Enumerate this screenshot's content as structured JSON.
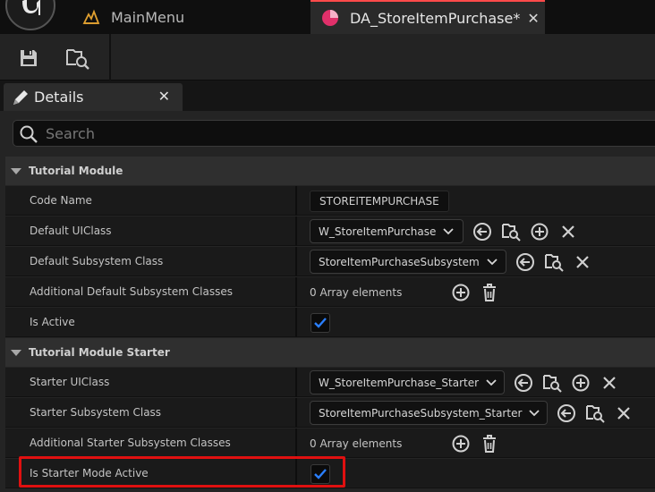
{
  "tabs": {
    "main_menu": "MainMenu",
    "active_asset": "DA_StoreItemPurchase*",
    "close": "✕"
  },
  "icons": {
    "unreal_logo": "unreal-logo-icon",
    "level": "level-icon",
    "data_asset": "data-asset-icon",
    "save": "save-icon",
    "browse": "browse-to-asset-icon",
    "details": "details-pencil-icon"
  },
  "details": {
    "title": "Details",
    "close": "✕",
    "search_placeholder": "Search"
  },
  "categories": [
    {
      "label": "Tutorial Module",
      "rows": [
        {
          "name": "Code Name",
          "value": "STOREITEMPURCHASE"
        },
        {
          "name": "Default UIClass",
          "value": "W_StoreItemPurchase"
        },
        {
          "name": "Default Subsystem Class",
          "value": "StoreItemPurchaseSubsystem"
        },
        {
          "name": "Additional Default Subsystem Classes",
          "value": "0 Array elements"
        },
        {
          "name": "Is Active",
          "checked": true
        }
      ]
    },
    {
      "label": "Tutorial Module Starter",
      "rows": [
        {
          "name": "Starter UIClass",
          "value": "W_StoreItemPurchase_Starter"
        },
        {
          "name": "Starter Subsystem Class",
          "value": "StoreItemPurchaseSubsystem_Starter"
        },
        {
          "name": "Additional Starter Subsystem Classes",
          "value": "0 Array elements"
        },
        {
          "name": "Is Starter Mode Active",
          "checked": true,
          "highlighted": true
        }
      ]
    }
  ],
  "colors": {
    "accent_blue": "#2a7fff",
    "active_tab_accent": "#ff4a4a",
    "highlight_red": "#e01010",
    "data_asset_pink": "#e0306a",
    "level_orange": "#e0a030"
  }
}
